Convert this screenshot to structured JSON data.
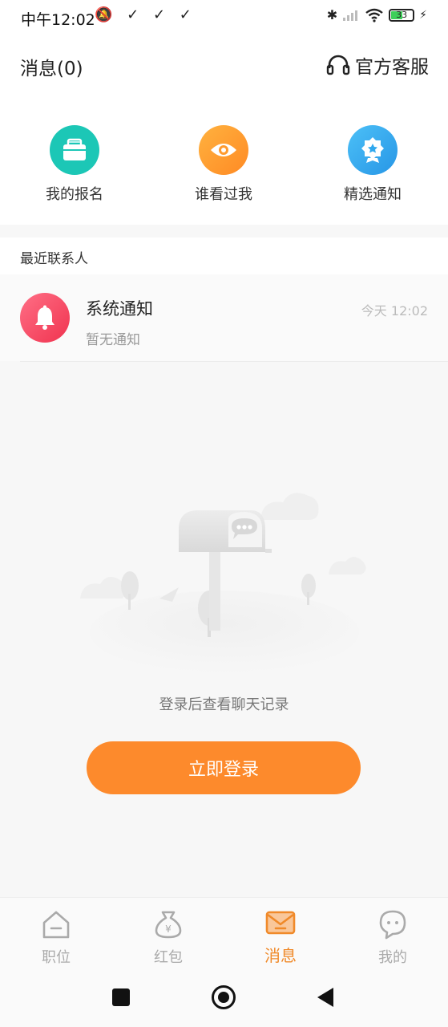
{
  "status_bar": {
    "time": "中午12:02",
    "left_icons": "✓ ✓ ✓",
    "battery": "33"
  },
  "header": {
    "title": "消息(0)",
    "customer_service": "官方客服"
  },
  "shortcuts": [
    {
      "label": "我的报名",
      "icon": "briefcase-icon",
      "color": "#1cc7b6"
    },
    {
      "label": "谁看过我",
      "icon": "eye-icon",
      "color": "#ff9a2e"
    },
    {
      "label": "精选通知",
      "icon": "badge-icon",
      "color": "#2fa8ee"
    }
  ],
  "recent": {
    "title": "最近联系人",
    "contacts": [
      {
        "name": "系统通知",
        "message": "暂无通知",
        "time": "今天 12:02",
        "icon": "bell-icon"
      }
    ]
  },
  "empty_state": {
    "text": "登录后查看聊天记录",
    "button": "立即登录"
  },
  "tabs": [
    {
      "label": "职位",
      "icon": "house-icon",
      "active": false
    },
    {
      "label": "红包",
      "icon": "money-bag-icon",
      "active": false
    },
    {
      "label": "消息",
      "icon": "envelope-icon",
      "active": true
    },
    {
      "label": "我的",
      "icon": "face-icon",
      "active": false
    }
  ],
  "colors": {
    "accent": "#fd8a2c",
    "active_tab": "#f08a2a"
  }
}
